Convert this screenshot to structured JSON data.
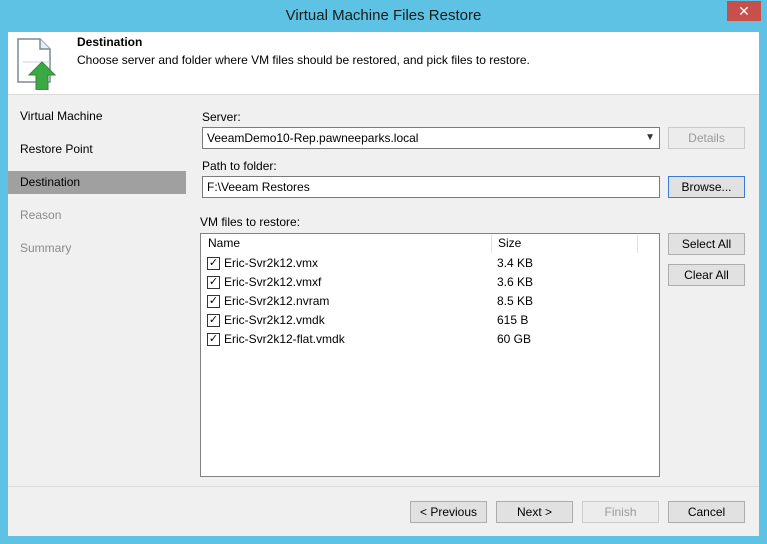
{
  "window": {
    "title": "Virtual Machine Files Restore",
    "close_glyph": "✕"
  },
  "header": {
    "title": "Destination",
    "description": "Choose server and folder where VM files should be restored, and pick files to restore.",
    "icon": "file-restore-icon"
  },
  "sidebar": {
    "items": [
      {
        "label": "Virtual Machine",
        "state": "normal"
      },
      {
        "label": "Restore Point",
        "state": "normal"
      },
      {
        "label": "Destination",
        "state": "active"
      },
      {
        "label": "Reason",
        "state": "disabled"
      },
      {
        "label": "Summary",
        "state": "disabled"
      }
    ]
  },
  "main": {
    "server_label": "Server:",
    "server_value": "VeeamDemo10-Rep.pawneeparks.local",
    "details_button": "Details",
    "path_label": "Path to folder:",
    "path_value": "F:\\Veeam Restores",
    "browse_button": "Browse...",
    "files_label": "VM files to restore:",
    "columns": {
      "name": "Name",
      "size": "Size"
    },
    "files": [
      {
        "name": "Eric-Svr2k12.vmx",
        "size": "3.4 KB",
        "checked": true
      },
      {
        "name": "Eric-Svr2k12.vmxf",
        "size": "3.6 KB",
        "checked": true
      },
      {
        "name": "Eric-Svr2k12.nvram",
        "size": "8.5 KB",
        "checked": true
      },
      {
        "name": "Eric-Svr2k12.vmdk",
        "size": "615 B",
        "checked": true
      },
      {
        "name": "Eric-Svr2k12-flat.vmdk",
        "size": "60 GB",
        "checked": true
      }
    ],
    "select_all_button": "Select All",
    "clear_all_button": "Clear All"
  },
  "footer": {
    "previous_button": "< Previous",
    "next_button": "Next >",
    "finish_button": "Finish",
    "cancel_button": "Cancel"
  },
  "colors": {
    "title_bar": "#5ec2e5",
    "close_button": "#c7504b",
    "sidebar_active": "#a0a0a0",
    "icon_arrow": "#3aa843"
  }
}
